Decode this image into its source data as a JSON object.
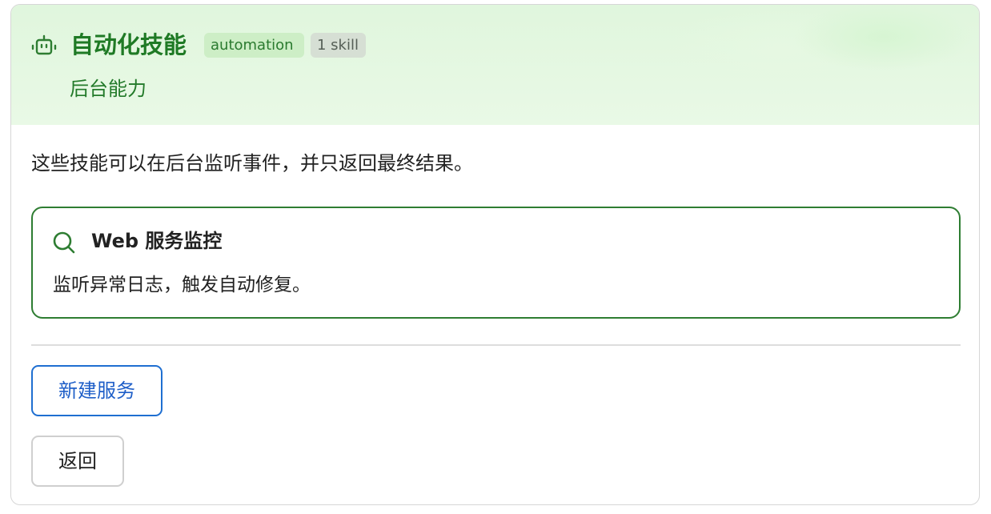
{
  "header": {
    "icon": "robot-icon",
    "title": "自动化技能",
    "tag_automation": "automation",
    "tag_skill_count": "1 skill",
    "subtitle": "后台能力"
  },
  "description": "这些技能可以在后台监听事件，并只返回最终结果。",
  "skill": {
    "icon": "search-icon",
    "title": "Web 服务监控",
    "description": "监听异常日志，触发自动修复。"
  },
  "actions": {
    "new_service_label": "新建服务",
    "back_label": "返回"
  },
  "colors": {
    "accent_green": "#1f7a25",
    "skill_border": "#2e7d32",
    "primary_blue": "#1f6fd1",
    "header_bg": "#e0f6dd"
  }
}
